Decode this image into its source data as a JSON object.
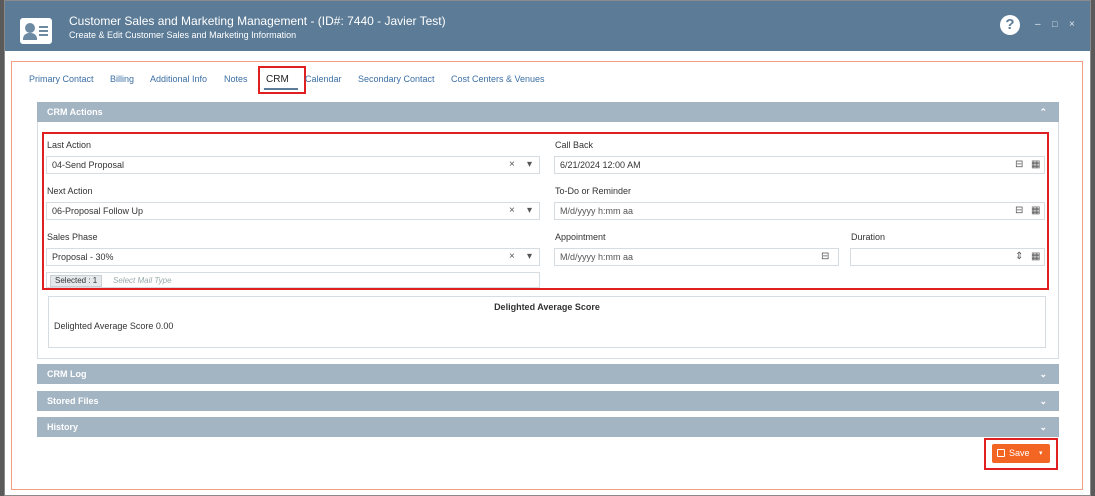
{
  "window": {
    "title": "Customer Sales and Marketing Management - (ID#: 7440 - Javier Test)",
    "subtitle": "Create & Edit Customer Sales and Marketing Information",
    "help_glyph": "?",
    "minimize_glyph": "–",
    "maximize_glyph": "□",
    "close_glyph": "×"
  },
  "tabs": [
    "Primary Contact",
    "Billing",
    "Additional Info",
    "Notes",
    "CRM",
    "Calendar",
    "Secondary Contact",
    "Cost Centers & Venues"
  ],
  "active_tab": "CRM",
  "crm_actions": {
    "header": "CRM Actions",
    "last_action": {
      "label": "Last Action",
      "value": "04-Send Proposal"
    },
    "next_action": {
      "label": "Next Action",
      "value": "06-Proposal Follow Up"
    },
    "sales_phase": {
      "label": "Sales Phase",
      "value": "Proposal - 30%"
    },
    "mail_type": {
      "chip": "Selected : 1",
      "placeholder": "Select Mail Type"
    },
    "call_back": {
      "label": "Call Back",
      "value": "6/21/2024 12:00 AM"
    },
    "todo": {
      "label": "To-Do or Reminder",
      "placeholder": "M/d/yyyy h:mm aa"
    },
    "appointment": {
      "label": "Appointment",
      "placeholder": "M/d/yyyy h:mm aa"
    },
    "duration": {
      "label": "Duration",
      "value": ""
    }
  },
  "score": {
    "title": "Delighted Average Score",
    "text": "Delighted Average Score 0.00"
  },
  "sections": {
    "crm_log": "CRM Log",
    "stored_files": "Stored Files",
    "history": "History"
  },
  "save_label": "Save",
  "glyphs": {
    "clear": "×",
    "dropdown": "▾",
    "chevron_up": "⌃",
    "chevron_down": "⌄",
    "calendar_clear": "⊟",
    "calendar": "▦",
    "spin": "⇕"
  },
  "colors": {
    "titlebar": "#5b7b96",
    "section_header": "#a3b4c3",
    "highlight": "#e02020",
    "save_button": "#f26522",
    "tab_link": "#3c6fa5"
  }
}
